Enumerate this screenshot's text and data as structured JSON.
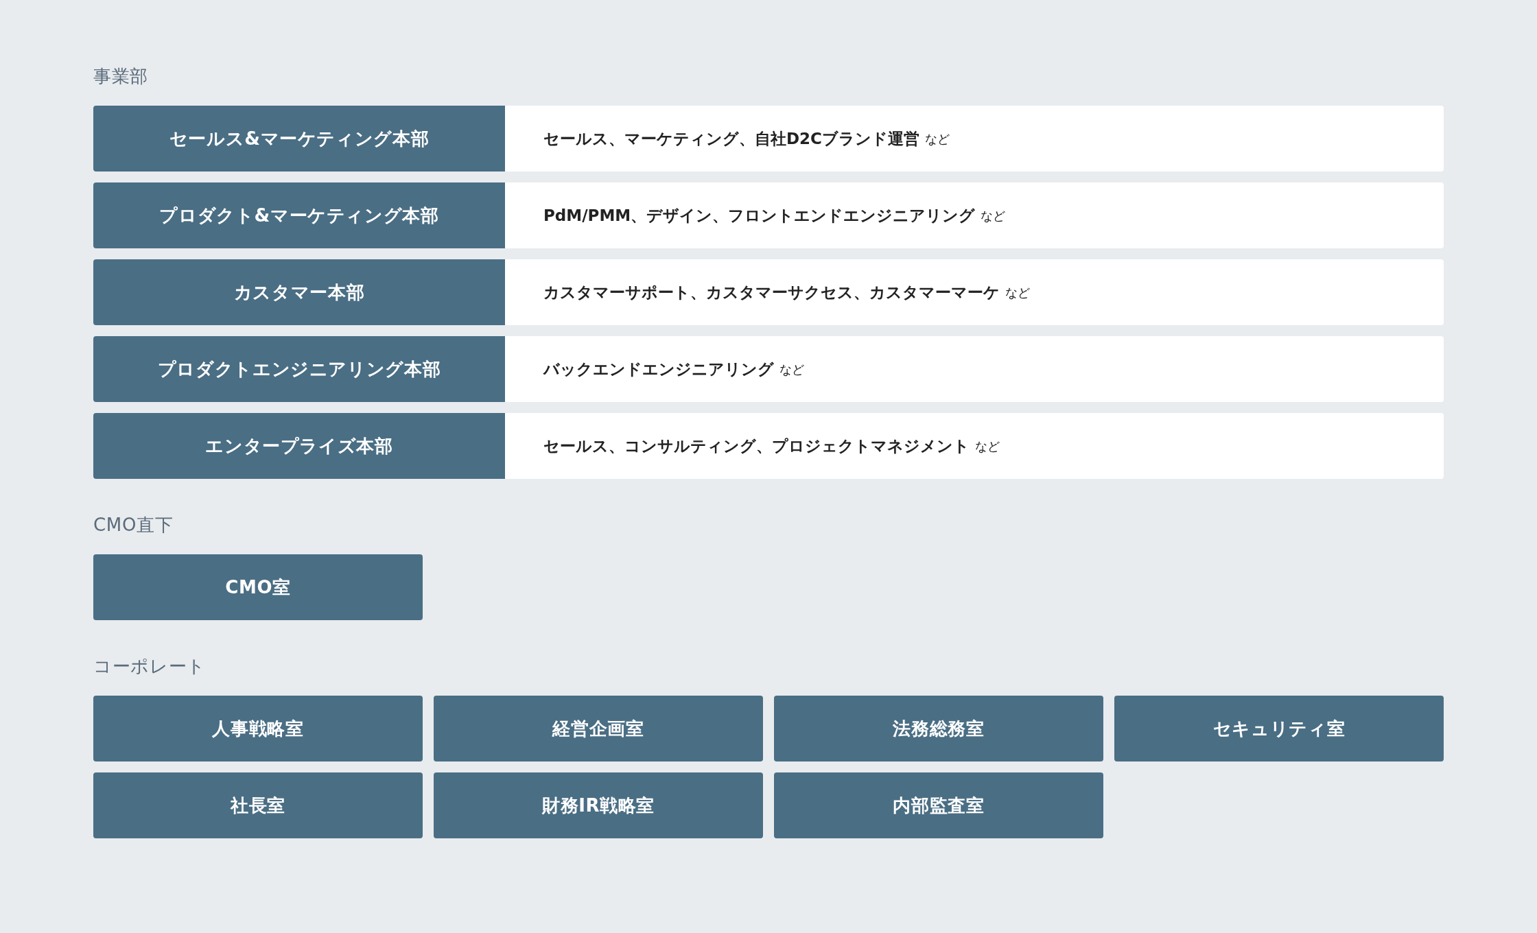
{
  "sections": [
    {
      "kind": "rows",
      "title": "事業部",
      "rows": [
        {
          "name": "セールス&マーケティング本部",
          "description": "セールス、マーケティング、自社D2Cブランド運営",
          "suffix": "など"
        },
        {
          "name": "プロダクト&マーケティング本部",
          "description": "PdM/PMM、デザイン、フロントエンドエンジニアリング",
          "suffix": "など"
        },
        {
          "name": "カスタマー本部",
          "description": "カスタマーサポート、カスタマーサクセス、カスタマーマーケ",
          "suffix": "など"
        },
        {
          "name": "プロダクトエンジニアリング本部",
          "description": "バックエンドエンジニアリング",
          "suffix": "など"
        },
        {
          "name": "エンタープライズ本部",
          "description": "セールス、コンサルティング、プロジェクトマネジメント",
          "suffix": "など"
        }
      ]
    },
    {
      "kind": "grid",
      "title": "CMO直下",
      "items": [
        "CMO室"
      ]
    },
    {
      "kind": "grid",
      "title": "コーポレート",
      "items": [
        "人事戦略室",
        "経営企画室",
        "法務総務室",
        "セキュリティ室",
        "社長室",
        "財務IR戦略室",
        "内部監査室"
      ]
    }
  ]
}
